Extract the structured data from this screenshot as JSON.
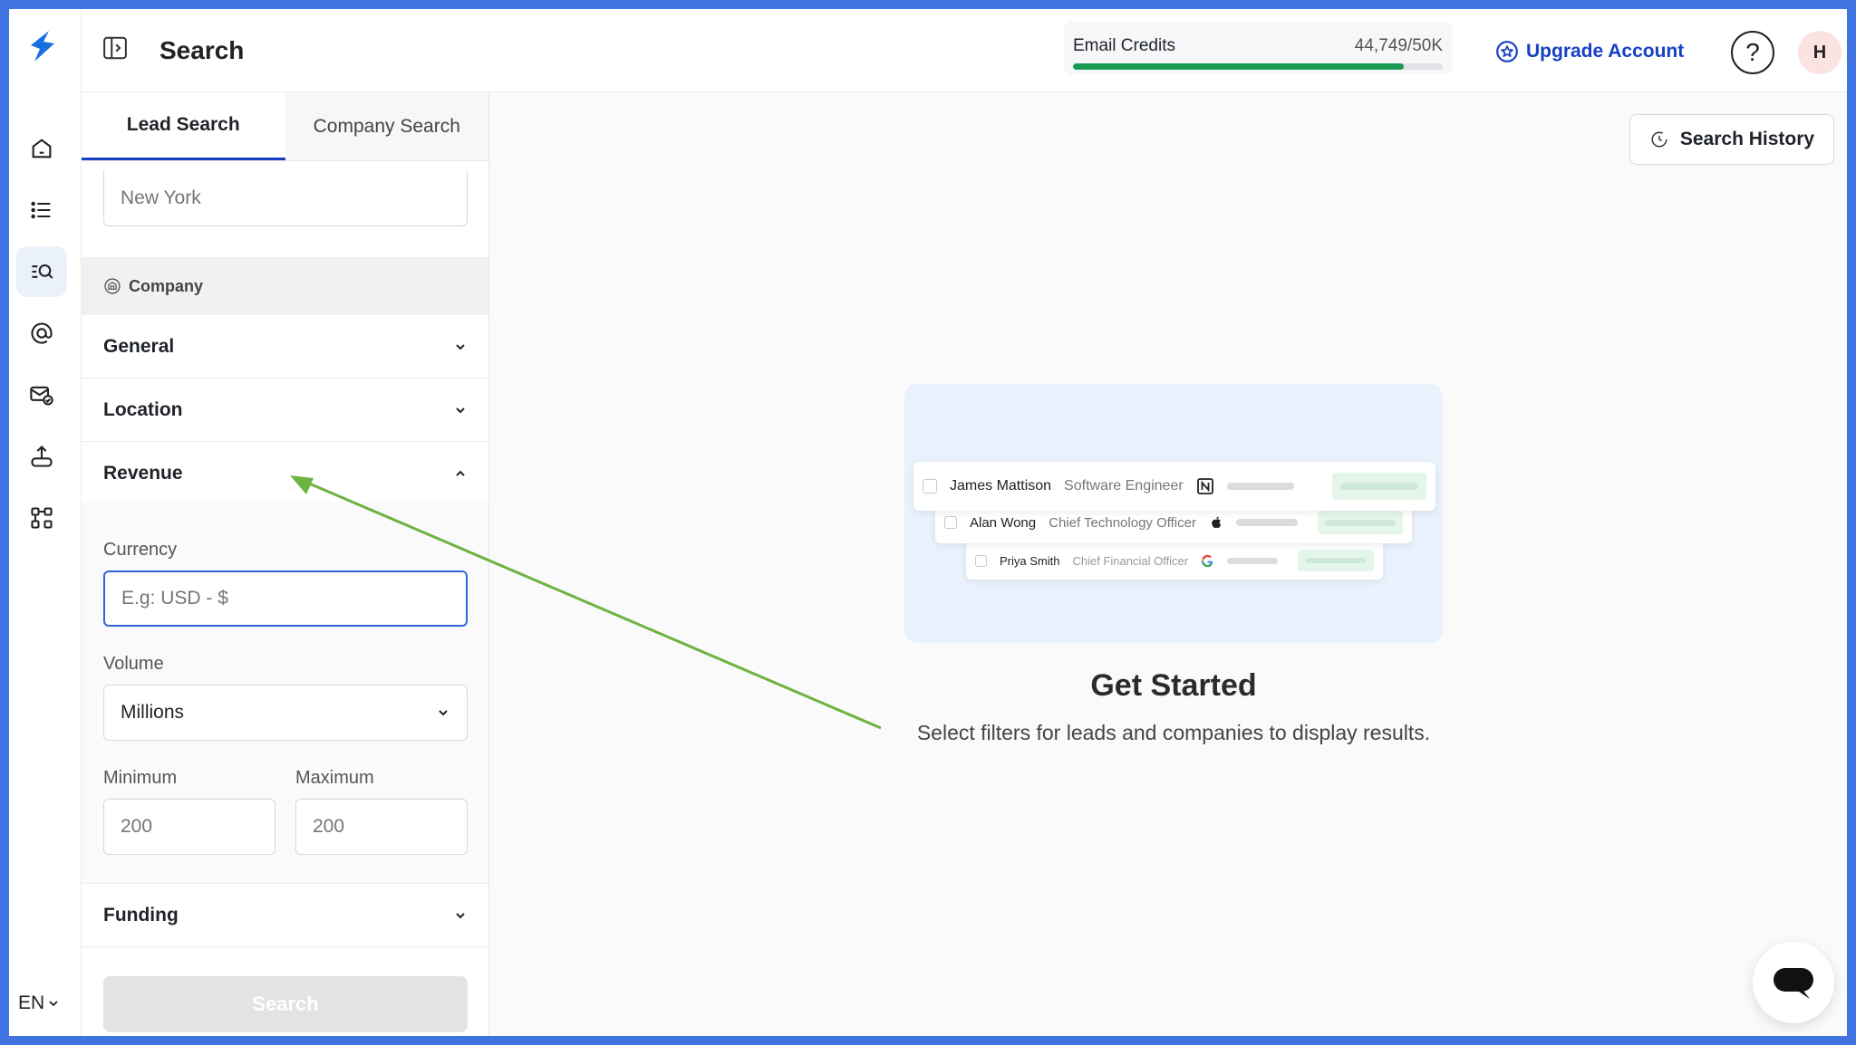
{
  "header": {
    "title": "Search",
    "credits": {
      "label": "Email Credits",
      "value": "44,749/50K",
      "fraction": 0.895
    },
    "upgrade_label": "Upgrade Account",
    "help_label": "?",
    "avatar_initial": "H"
  },
  "rail": {
    "items": [
      "home-icon",
      "list-icon",
      "lead-search-icon",
      "at-sign-icon",
      "mail-check-icon",
      "upload-icon",
      "workflow-icon"
    ],
    "active": "lead-search-icon",
    "language": "EN"
  },
  "panel": {
    "tabs": [
      {
        "label": "Lead Search",
        "active": true
      },
      {
        "label": "Company Search",
        "active": false
      }
    ],
    "city_placeholder": "New York",
    "company_header": "Company",
    "sections": {
      "general": "General",
      "location": "Location",
      "revenue": "Revenue",
      "funding": "Funding"
    },
    "revenue": {
      "currency_label": "Currency",
      "currency_placeholder": "E.g: USD - $",
      "volume_label": "Volume",
      "volume_value": "Millions",
      "minimum_label": "Minimum",
      "minimum_placeholder": "200",
      "maximum_label": "Maximum",
      "maximum_placeholder": "200"
    },
    "search_label": "Search"
  },
  "main": {
    "history_label": "Search History",
    "preview_rows": [
      {
        "name": "James Mattison",
        "role": "Software Engineer",
        "logo": "notion-icon"
      },
      {
        "name": "Alan Wong",
        "role": "Chief Technology Officer",
        "logo": "apple-icon"
      },
      {
        "name": "Priya Smith",
        "role": "Chief Financial Officer",
        "logo": "google-icon"
      }
    ],
    "title": "Get Started",
    "subtitle": "Select filters for leads and companies to display results."
  },
  "colors": {
    "accent": "#1640c4",
    "progress": "#1a9b54",
    "annotation_arrow": "#6cb33f",
    "frame": "#3f73e0"
  }
}
